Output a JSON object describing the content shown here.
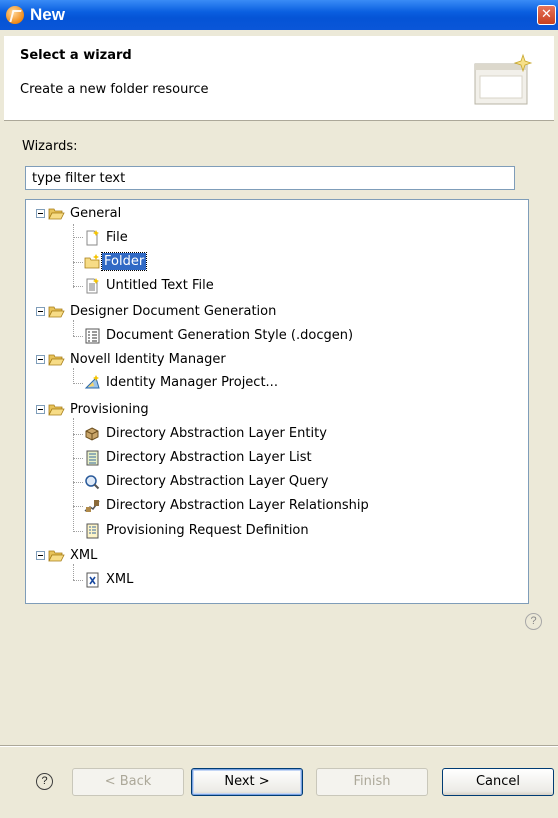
{
  "window": {
    "title": "New",
    "close_symbol": "✕"
  },
  "header": {
    "title": "Select a wizard",
    "description": "Create a new folder resource",
    "banner_icon": "new-wizard-banner-icon"
  },
  "wizards_label": "Wizards:",
  "filter": {
    "value": "type filter text"
  },
  "tree": {
    "items": [
      {
        "label": "General",
        "icon": "folder-open-icon",
        "type": "category"
      },
      {
        "label": "File",
        "icon": "file-icon",
        "type": "item"
      },
      {
        "label": "Folder",
        "icon": "folder-icon",
        "type": "item",
        "selected": true
      },
      {
        "label": "Untitled Text File",
        "icon": "text-file-icon",
        "type": "item"
      },
      {
        "label": "Designer Document Generation",
        "icon": "folder-open-icon",
        "type": "category"
      },
      {
        "label": "Document Generation Style (.docgen)",
        "icon": "docgen-icon",
        "type": "item"
      },
      {
        "label": "Novell Identity Manager",
        "icon": "folder-open-icon",
        "type": "category"
      },
      {
        "label": "Identity Manager Project...",
        "icon": "idm-project-icon",
        "type": "item"
      },
      {
        "label": "Provisioning",
        "icon": "folder-open-icon",
        "type": "category"
      },
      {
        "label": "Directory Abstraction Layer Entity",
        "icon": "entity-icon",
        "type": "item"
      },
      {
        "label": "Directory Abstraction Layer List",
        "icon": "list-icon",
        "type": "item"
      },
      {
        "label": "Directory Abstraction Layer Query",
        "icon": "query-icon",
        "type": "item"
      },
      {
        "label": "Directory Abstraction Layer Relationship",
        "icon": "relationship-icon",
        "type": "item"
      },
      {
        "label": "Provisioning Request Definition",
        "icon": "request-definition-icon",
        "type": "item"
      },
      {
        "label": "XML",
        "icon": "folder-open-icon",
        "type": "category"
      },
      {
        "label": "XML",
        "icon": "xml-file-icon",
        "type": "item"
      }
    ]
  },
  "buttons": {
    "help_symbol": "?",
    "back": "< Back",
    "next": "Next >",
    "finish": "Finish",
    "cancel": "Cancel"
  },
  "colors": {
    "selection": "#316ac5",
    "titlebar": "#0554d6",
    "dialog_bg": "#ece9d8"
  }
}
